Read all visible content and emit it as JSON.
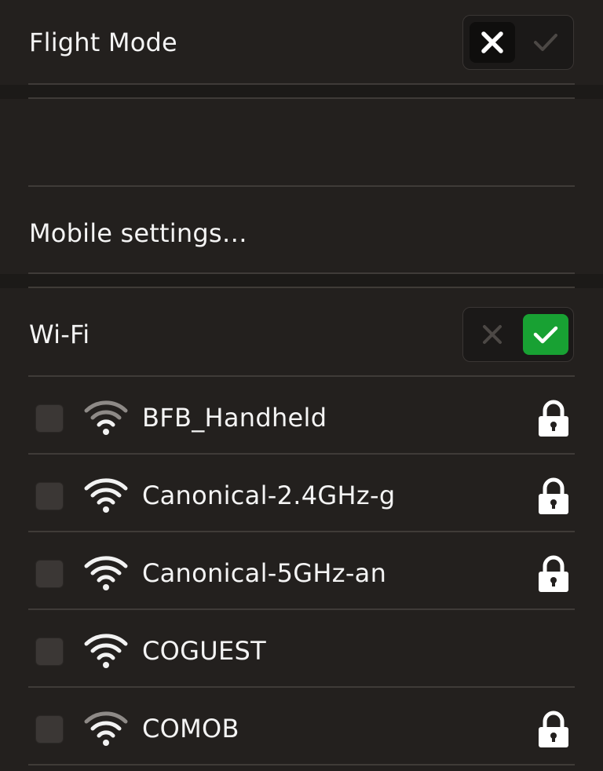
{
  "flight_mode": {
    "label": "Flight Mode",
    "state": "off"
  },
  "mobile": {
    "settings_label": "Mobile settings…"
  },
  "wifi": {
    "label": "Wi-Fi",
    "state": "on",
    "networks": [
      {
        "name": "BFB_Handheld",
        "signal": "medium",
        "secured": true
      },
      {
        "name": "Canonical-2.4GHz-g",
        "signal": "full",
        "secured": true
      },
      {
        "name": "Canonical-5GHz-an",
        "signal": "full",
        "secured": true
      },
      {
        "name": "COGUEST",
        "signal": "full",
        "secured": false
      },
      {
        "name": "COMOB",
        "signal": "medium",
        "secured": true
      }
    ]
  },
  "colors": {
    "background": "#23201e",
    "toggle_on": "#18a133",
    "divider": "#3f3b38"
  },
  "icons": {
    "toggle_off": "x-icon",
    "toggle_on": "check-icon",
    "network": "wifi-signal-icon",
    "secured": "lock-icon"
  }
}
